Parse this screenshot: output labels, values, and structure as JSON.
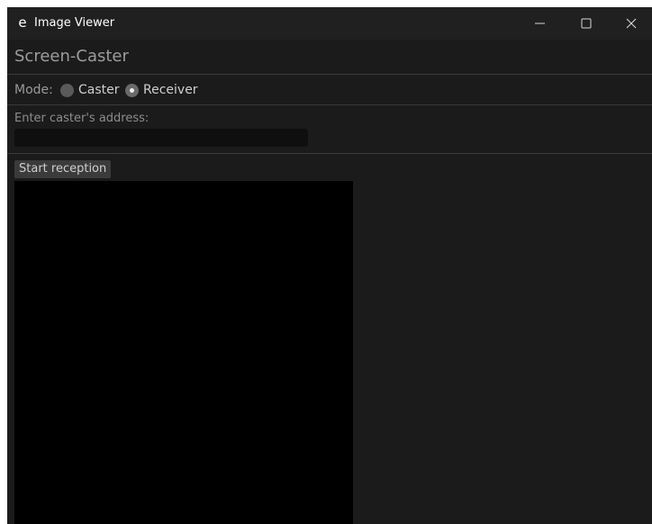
{
  "window": {
    "title": "Image Viewer",
    "app_icon": "e"
  },
  "app": {
    "heading": "Screen-Caster",
    "mode": {
      "label": "Mode:",
      "options": [
        {
          "label": "Caster",
          "selected": false
        },
        {
          "label": "Receiver",
          "selected": true
        }
      ]
    },
    "address": {
      "label": "Enter caster's address:",
      "value": "",
      "placeholder": ""
    },
    "start_button": "Start reception"
  },
  "icons": {
    "minimize": "minimize-icon",
    "maximize": "maximize-icon",
    "close": "close-icon"
  },
  "colors": {
    "window_bg": "#1b1b1b",
    "titlebar_bg": "#202020",
    "viewer_bg": "#000000"
  }
}
